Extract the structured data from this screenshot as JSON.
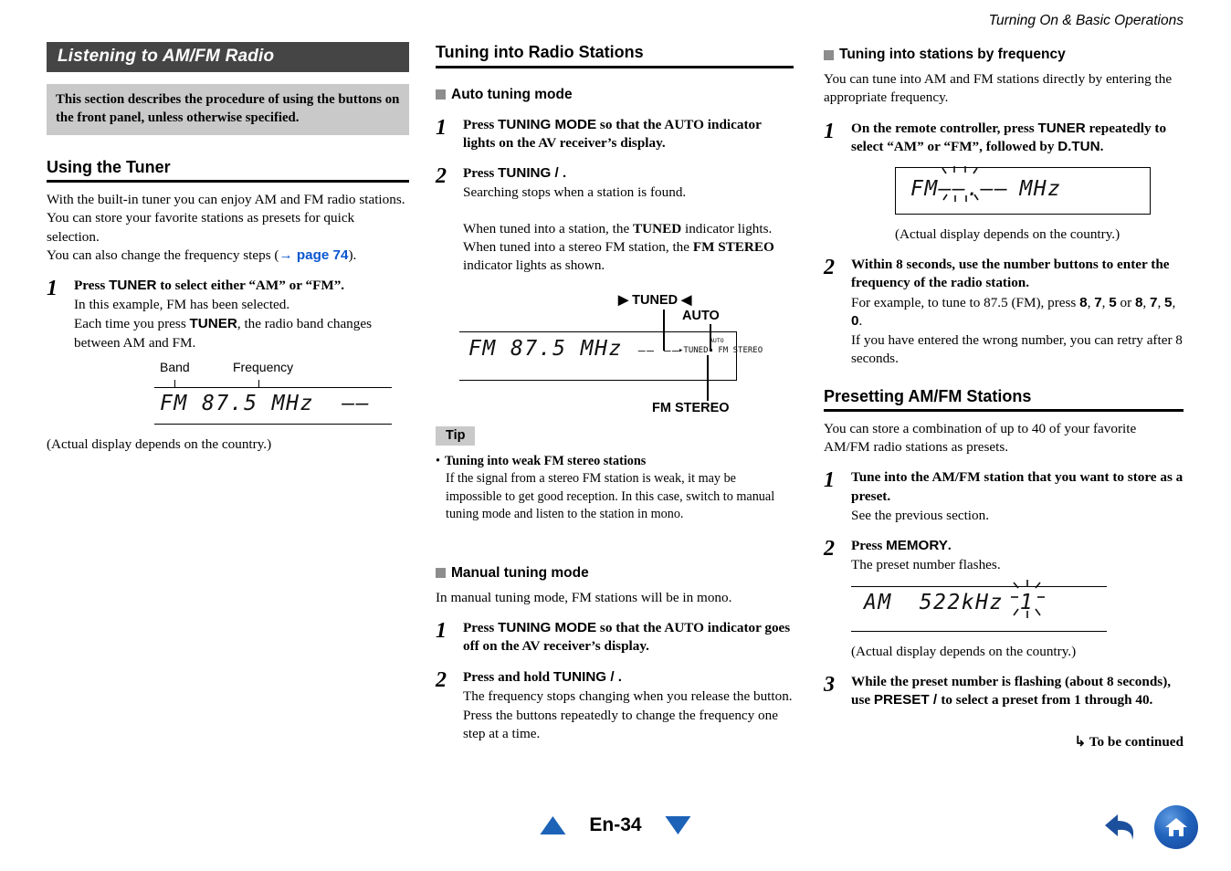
{
  "header": {
    "running_head": "Turning On & Basic Operations"
  },
  "col1": {
    "section_title": "Listening to AM/FM Radio",
    "note": "This section describes the procedure of using the buttons on the front panel, unless otherwise specified.",
    "heading": "Using the Tuner",
    "intro_1": "With the built-in tuner you can enjoy AM and FM radio stations. You can store your favorite stations as presets for quick selection.",
    "intro_2_before": "You can also change the frequency steps (",
    "intro_2_link": "→ page 74",
    "intro_2_after": ").",
    "step1": {
      "num": "1",
      "head_a": "Press ",
      "head_b": "TUNER",
      "head_c": " to select either “AM” or “FM”.",
      "sub1": "In this example, FM has been selected.",
      "sub2_a": "Each time you press ",
      "sub2_b": "TUNER",
      "sub2_c": ", the radio band changes between AM and FM."
    },
    "display": {
      "label_band": "Band",
      "label_frequency": "Frequency",
      "text": "FM 87.5 MHz  ––"
    },
    "caption": "(Actual display depends on the country.)"
  },
  "col2": {
    "heading": "Tuning into Radio Stations",
    "sub_auto": "Auto tuning mode",
    "auto_step1": {
      "num": "1",
      "head_a": "Press ",
      "head_b": "TUNING MODE",
      "head_c": " so that the ",
      "head_d": "AUTO",
      "head_e": " indicator lights on the AV receiver’s display."
    },
    "auto_step2": {
      "num": "2",
      "head_a": "Press ",
      "head_b": "TUNING",
      "head_c": "  /  .",
      "sub": "Searching stops when a station is found."
    },
    "tuned_para_a": "When tuned into a station, the ",
    "tuned_para_b": "TUNED",
    "tuned_para_c": " indicator lights. When tuned into a stereo FM station, the ",
    "tuned_para_d": "FM STEREO",
    "tuned_para_e": " indicator lights as shown.",
    "display2": {
      "callout_tuned": "▶ TUNED ◀",
      "callout_auto": "AUTO",
      "callout_fm_stereo": "FM STEREO",
      "text": "FM 87.5 MHz",
      "dashes": "–– ––",
      "tiny_indicators": "▸TUNED◂ FM STEREO",
      "tiny_auto": "AUTO"
    },
    "tip": {
      "tag": "Tip",
      "bullet_head": "Tuning into weak FM stereo stations",
      "bullet_body": "If the signal from a stereo FM station is weak, it may be impossible to get good reception. In this case, switch to manual tuning mode and listen to the station in mono."
    },
    "sub_manual": "Manual tuning mode",
    "manual_intro": "In manual tuning mode, FM stations will be in mono.",
    "manual_step1": {
      "num": "1",
      "head_a": "Press ",
      "head_b": "TUNING MODE",
      "head_c": " so that the ",
      "head_d": "AUTO",
      "head_e": " indicator goes off on the AV receiver’s display."
    },
    "manual_step2": {
      "num": "2",
      "head_a": "Press and hold ",
      "head_b": "TUNING",
      "head_c": "  /  .",
      "sub1": "The frequency stops changing when you release the button.",
      "sub2": "Press the buttons repeatedly to change the frequency one step at a time."
    }
  },
  "col3": {
    "sub_freq": "Tuning into stations by frequency",
    "freq_intro": "You can tune into AM and FM stations directly by entering the appropriate frequency.",
    "freq_step1": {
      "num": "1",
      "head_a": "On the remote controller, press ",
      "head_b": "TUNER",
      "head_c": " repeatedly to select “AM” or “FM”, followed by ",
      "head_d": "D.TUN",
      "head_e": "."
    },
    "display3": {
      "band": "FM",
      "value": "––.––",
      "unit": "MHz"
    },
    "caption3": "(Actual display depends on the country.)",
    "freq_step2": {
      "num": "2",
      "head": "Within 8 seconds, use the number buttons to enter the frequency of the radio station.",
      "sub1_a": "For example, to tune to 87.5 (FM), press ",
      "sub1_k1": "8",
      "sub1_sep1": ", ",
      "sub1_k2": "7",
      "sub1_sep2": ", ",
      "sub1_k3": "5",
      "sub1_or": " or ",
      "sub1_k4": "8",
      "sub1_sep3": ", ",
      "sub1_k5": "7",
      "sub1_sep4": ", ",
      "sub1_k6": "5",
      "sub1_sep5": ", ",
      "sub1_k7": "0",
      "sub1_end": ".",
      "sub2": "If you have entered the wrong number, you can retry after 8 seconds."
    },
    "heading_preset": "Presetting AM/FM Stations",
    "preset_intro": "You can store a combination of up to 40 of your favorite AM/FM radio stations as presets.",
    "preset_step1": {
      "num": "1",
      "head": "Tune into the AM/FM station that you want to store as a preset.",
      "sub": "See the previous section."
    },
    "preset_step2": {
      "num": "2",
      "head_a": "Press ",
      "head_b": "MEMORY",
      "head_c": ".",
      "sub": "The preset number flashes."
    },
    "display4": {
      "band": "AM",
      "value": "522kHz",
      "preset": "1"
    },
    "caption4": "(Actual display depends on the country.)",
    "preset_step3": {
      "num": "3",
      "head_a": "While the preset number is flashing (about 8 seconds), use ",
      "head_b": "PRESET",
      "head_c": "  /  ",
      "head_d": " to select a preset from 1 through 40."
    },
    "to_be_continued": "↳ To be continued"
  },
  "footer": {
    "page_number": "En-34",
    "prev_icon": "triangle-up-icon",
    "next_icon": "triangle-down-icon",
    "back_icon": "back-arrow-icon",
    "home_icon": "home-icon"
  },
  "colors": {
    "title_bar_bg": "#454545",
    "note_bg": "#c9c9c9",
    "link": "#0b57d0",
    "nav_blue": "#1c63b8",
    "sub_square": "#8d8d8d"
  }
}
